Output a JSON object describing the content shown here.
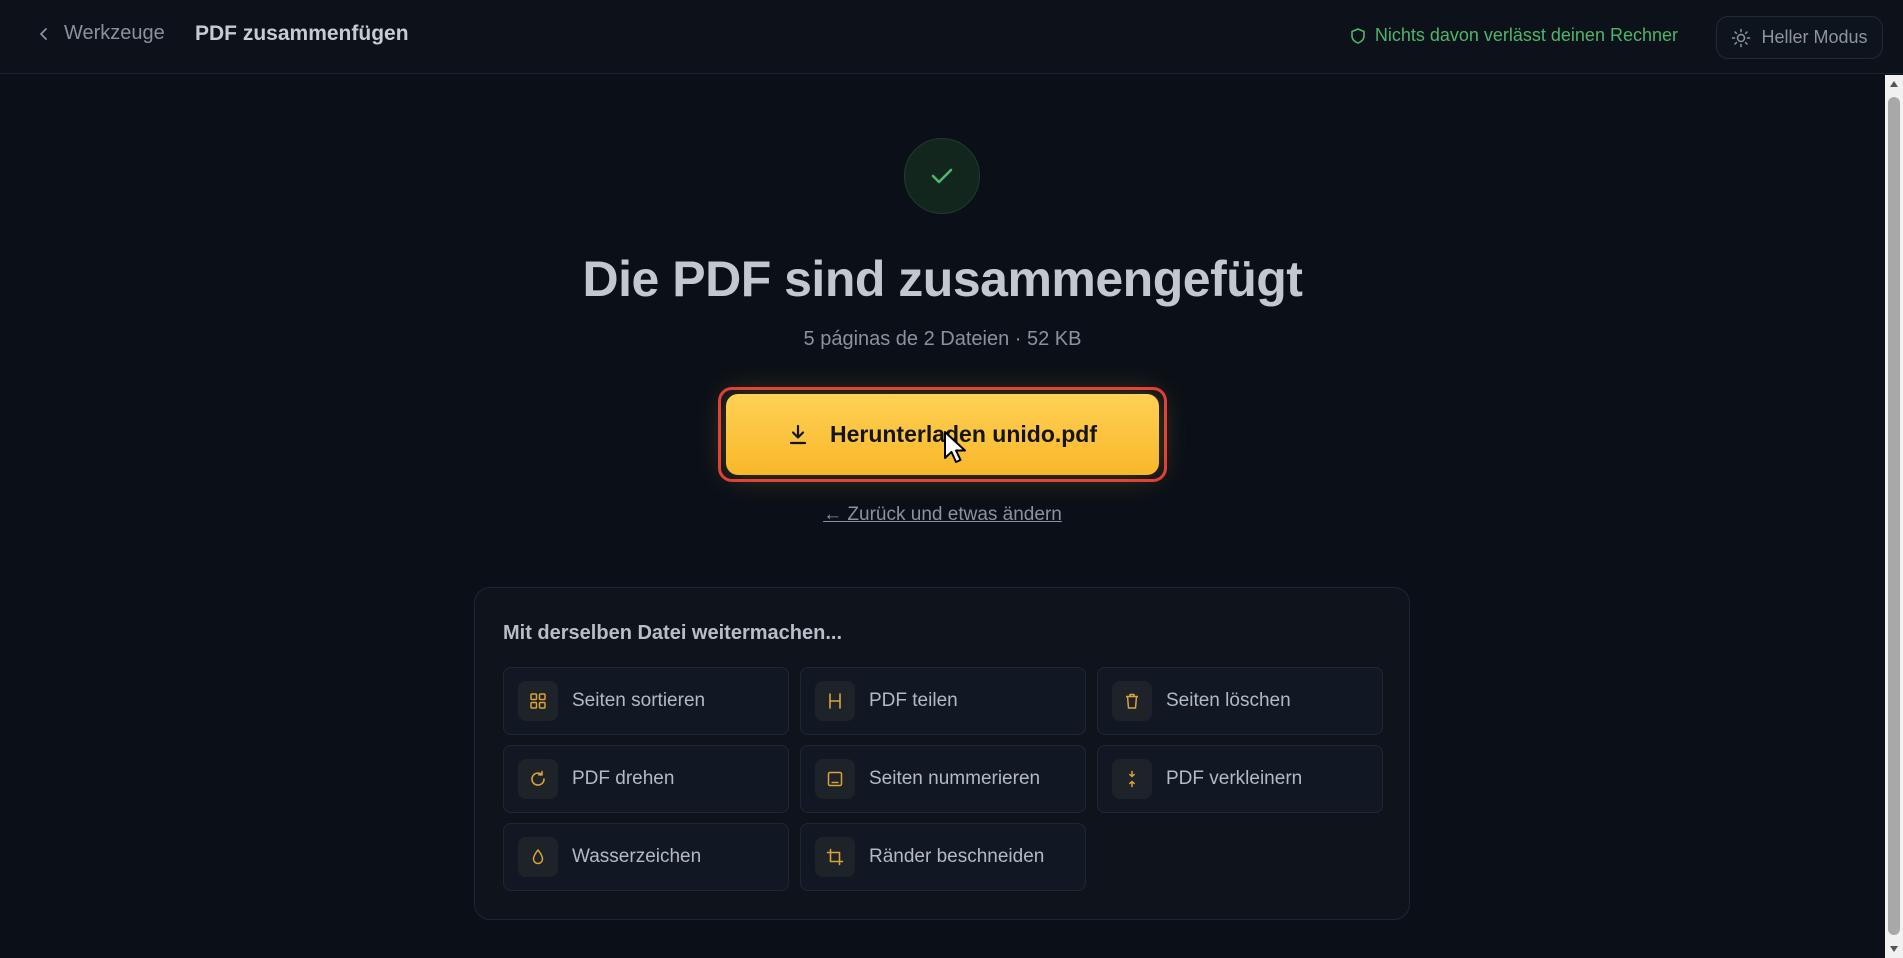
{
  "header": {
    "back_label": "Werkzeuge",
    "title": "PDF zusammenfügen",
    "privacy_text": "Nichts davon verlässt deinen Rechner",
    "theme_label": "Heller Modus"
  },
  "result": {
    "title": "Die PDF sind zusammengefügt",
    "subtitle": "5 páginas de 2 Dateien · 52 KB",
    "download_label": "Herunterladen unido.pdf",
    "back_change_label": "← Zurück und etwas ändern"
  },
  "continue": {
    "title": "Mit derselben Datei weitermachen...",
    "tools": [
      {
        "label": "Seiten sortieren",
        "icon": "grid-icon"
      },
      {
        "label": "PDF teilen",
        "icon": "split-icon"
      },
      {
        "label": "Seiten löschen",
        "icon": "trash-icon"
      },
      {
        "label": "PDF drehen",
        "icon": "rotate-icon"
      },
      {
        "label": "Seiten nummerieren",
        "icon": "page-number-icon"
      },
      {
        "label": "PDF verkleinern",
        "icon": "compress-icon"
      },
      {
        "label": "Wasserzeichen",
        "icon": "droplet-icon"
      },
      {
        "label": "Ränder beschneiden",
        "icon": "crop-icon"
      }
    ]
  },
  "colors": {
    "background": "#0b1018",
    "accent": "#f8b72a",
    "success": "#4fb56a",
    "highlight": "#e03a36"
  }
}
